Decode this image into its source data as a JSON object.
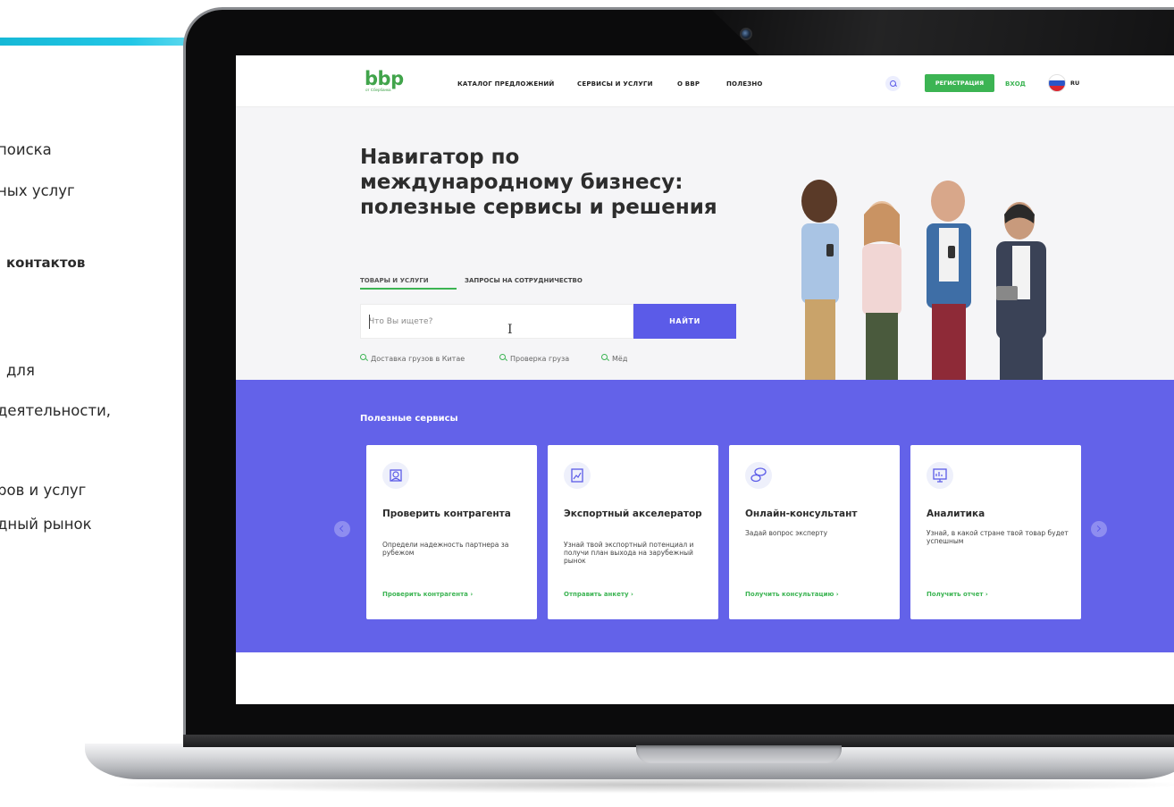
{
  "slide_text": {
    "lines": [
      "поиска",
      "ных услуг",
      "контактов",
      "для",
      "деятельности,",
      "ров и услуг",
      "дный рынок"
    ]
  },
  "site": {
    "logo": {
      "word": "bbp",
      "sub": "от Сбербанка"
    },
    "nav": [
      "КАТАЛОГ ПРЕДЛОЖЕНИЙ",
      "СЕРВИСЫ И УСЛУГИ",
      "О BBP",
      "ПОЛЕЗНО"
    ],
    "register_label": "РЕГИСТРАЦИЯ",
    "login_label": "ВХОД",
    "language": "RU",
    "hero": {
      "title": "Навигатор по международному бизнесу: полезные сервисы и решения",
      "tabs": [
        "ТОВАРЫ И УСЛУГИ",
        "ЗАПРОСЫ НА СОТРУДНИЧЕСТВО"
      ],
      "search_placeholder": "Что Вы ищете?",
      "search_button": "НАЙТИ",
      "hints": [
        "Доставка грузов в Китае",
        "Проверка груза",
        "Мёд"
      ]
    },
    "services": {
      "title": "Полезные сервисы",
      "cards": [
        {
          "title": "Проверить контрагента",
          "text": "Определи надежность партнера за рубежом",
          "link": "Проверить контрагента ›",
          "icon": "face-scan-icon"
        },
        {
          "title": "Экспортный акселератор",
          "text": "Узнай твой экспортный потенциал и получи план выхода на зарубежный рынок",
          "link": "Отправить анкету ›",
          "icon": "document-chart-icon"
        },
        {
          "title": "Онлайн-консультант",
          "text": "Задай вопрос эксперту",
          "link": "Получить консультацию ›",
          "icon": "chat-bubbles-icon"
        },
        {
          "title": "Аналитика",
          "text": "Узнай, в какой стране твой товар будет успешным",
          "link": "Получить отчет ›",
          "icon": "presentation-chart-icon"
        }
      ]
    }
  },
  "colors": {
    "accent_green": "#3cb453",
    "accent_purple": "#6362e9",
    "slide_accent": "#22c7e6"
  }
}
